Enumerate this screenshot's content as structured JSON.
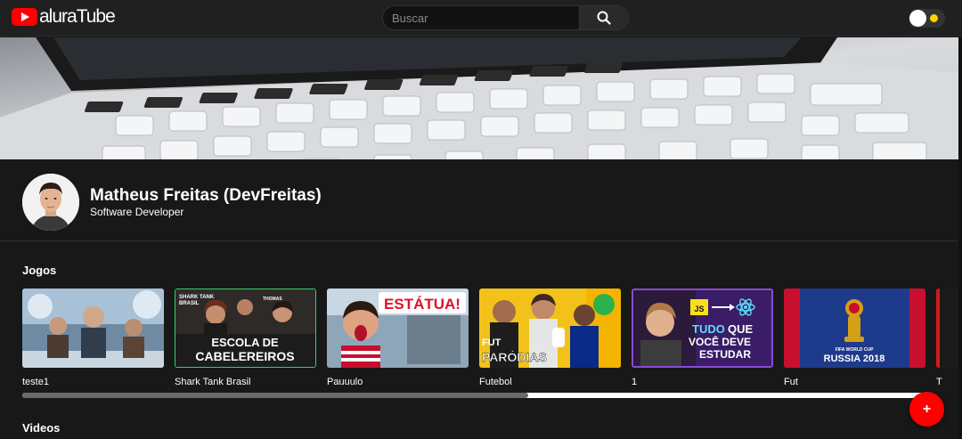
{
  "header": {
    "logo_text": "aluraTube",
    "search_placeholder": "Buscar",
    "colors": {
      "brand": "#ff0000",
      "toggle_sun": "#ffd200",
      "header_bg": "#202020"
    }
  },
  "profile": {
    "name": "Matheus Freitas (DevFreitas)",
    "role": "Software Developer"
  },
  "sections": [
    {
      "title": "Jogos",
      "videos": [
        {
          "title": "teste1",
          "thumb_text": []
        },
        {
          "title": "Shark Tank Brasil",
          "thumb_text": [
            "SHARK TANK",
            "BRASIL",
            "THOMAS",
            "ESCOLA DE",
            "CABELEREIROS"
          ]
        },
        {
          "title": "Pauuulo",
          "thumb_text": [
            "ESTÁTUA!"
          ]
        },
        {
          "title": "Futebol",
          "thumb_text": [
            "FUT",
            "PARÓDIAS"
          ]
        },
        {
          "title": "1",
          "thumb_text": [
            "JS",
            "TUDO",
            "QUE",
            "VOCÊ DEVE",
            "ESTUDAR"
          ]
        },
        {
          "title": "Fut",
          "thumb_text": [
            "FIFA WORLD CUP",
            "RUSSIA 2018"
          ]
        },
        {
          "title": "T",
          "thumb_text": []
        }
      ]
    },
    {
      "title": "Videos",
      "videos": []
    }
  ],
  "scroll": {
    "progress": 0.56
  },
  "fab": {
    "label": "+"
  }
}
